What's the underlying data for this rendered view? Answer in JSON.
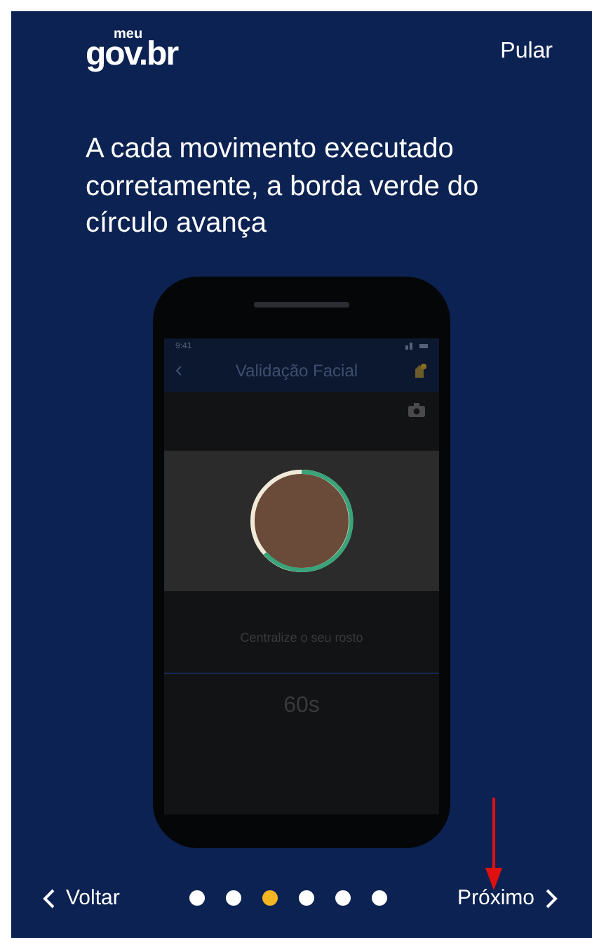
{
  "header": {
    "logo_top": "meu",
    "logo_main": "gov.br",
    "skip": "Pular"
  },
  "heading": "A cada movimento executado corretamente, a borda verde do círculo avança",
  "phone": {
    "status_time": "9:41",
    "title": "Validação Facial",
    "instruction": "Centralize o seu rosto",
    "timer": "60s"
  },
  "footer": {
    "back": "Voltar",
    "next": "Próximo",
    "dots": [
      {
        "selected": false
      },
      {
        "selected": false
      },
      {
        "selected": true
      },
      {
        "selected": false
      },
      {
        "selected": false
      },
      {
        "selected": false
      }
    ]
  }
}
